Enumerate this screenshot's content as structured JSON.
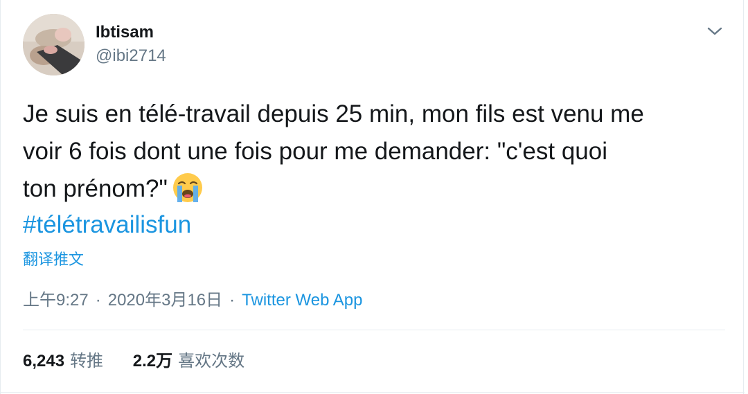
{
  "user": {
    "name": "Ibtisam",
    "handle": "@ibi2714"
  },
  "tweet": {
    "text": "Je suis en télé-travail depuis 25 min, mon fils est venu me\nvoir 6 fois dont une fois pour me demander: \"c'est quoi\nton prénom?\"",
    "emoji": "loudly-crying-face",
    "hashtag": "#télétravailisfun",
    "translate_label": "翻译推文"
  },
  "meta": {
    "time": "上午9:27",
    "separator": "·",
    "date": "2020年3月16日",
    "source": "Twitter Web App"
  },
  "stats": {
    "retweets_count": "6,243",
    "retweets_label": "转推",
    "likes_count": "2.2万",
    "likes_label": "喜欢次数"
  },
  "colors": {
    "link": "#1b95e0",
    "secondary_text": "#657786",
    "primary_text": "#14171a",
    "divider": "#e6ecf0"
  },
  "icons": {
    "menu": "chevron-down-icon",
    "emoji": "crying-face-emoji"
  }
}
